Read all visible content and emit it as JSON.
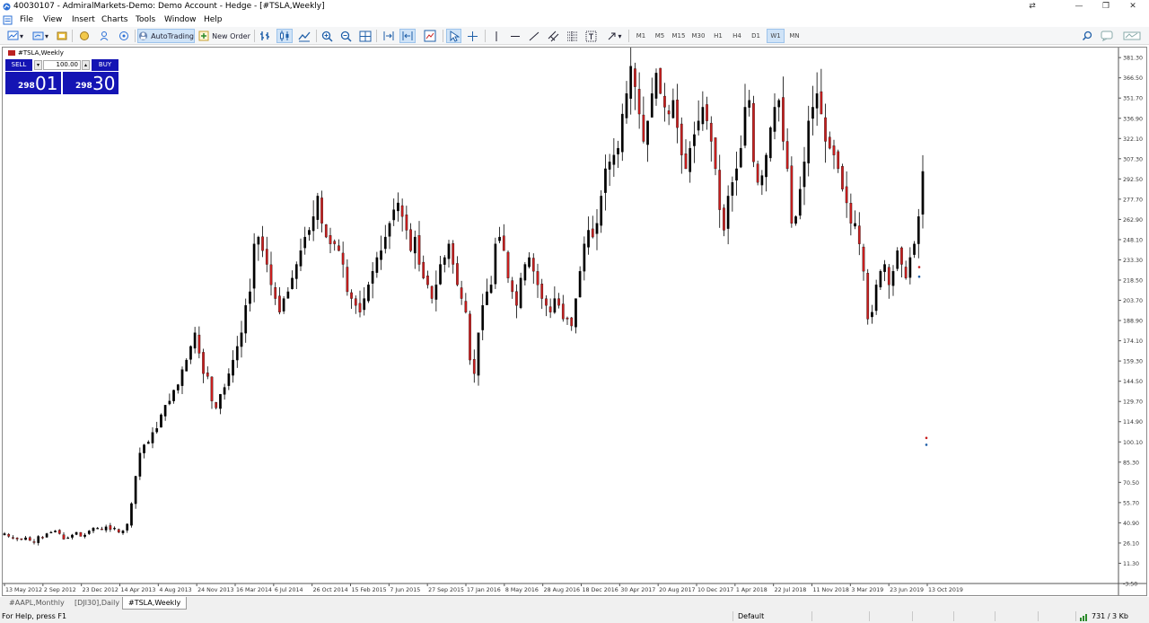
{
  "window": {
    "title": "40030107 - AdmiralMarkets-Demo: Demo Account - Hedge - [#TSLA,Weekly]"
  },
  "menu": [
    "File",
    "View",
    "Insert",
    "Charts",
    "Tools",
    "Window",
    "Help"
  ],
  "toolbar": {
    "autotrading_label": "AutoTrading",
    "new_order_label": "New Order",
    "timeframes": [
      "M1",
      "M5",
      "M15",
      "M30",
      "H1",
      "H4",
      "D1",
      "W1",
      "MN"
    ],
    "active_timeframe": "W1"
  },
  "chart": {
    "symbol_label": "#TSLA,Weekly",
    "oneclick": {
      "sell_label": "SELL",
      "buy_label": "BUY",
      "lot": "100.00",
      "sell_price_small": "298",
      "sell_price_big": "01",
      "buy_price_small": "298",
      "buy_price_big": "30"
    },
    "colors": {
      "bull": "#1e5a1e",
      "bear": "#c81e1e",
      "axis": "#555555"
    }
  },
  "chart_data": {
    "type": "candlestick",
    "symbol": "#TSLA",
    "timeframe": "Weekly",
    "y_ticks": [
      "381.30",
      "366.50",
      "351.70",
      "336.90",
      "322.10",
      "307.30",
      "292.50",
      "277.70",
      "262.90",
      "248.10",
      "233.30",
      "218.50",
      "203.70",
      "188.90",
      "174.10",
      "159.30",
      "144.50",
      "129.70",
      "114.90",
      "100.10",
      "85.30",
      "70.50",
      "55.70",
      "40.90",
      "26.10",
      "11.30",
      "-3.50"
    ],
    "x_ticks": [
      "13 May 2012",
      "2 Sep 2012",
      "23 Dec 2012",
      "14 Apr 2013",
      "4 Aug 2013",
      "24 Nov 2013",
      "16 Mar 2014",
      "6 Jul 2014",
      "26 Oct 2014",
      "15 Feb 2015",
      "7 Jun 2015",
      "27 Sep 2015",
      "17 Jan 2016",
      "8 May 2016",
      "28 Aug 2016",
      "18 Dec 2016",
      "30 Apr 2017",
      "20 Aug 2017",
      "10 Dec 2017",
      "1 Apr 2018",
      "22 Jul 2018",
      "11 Nov 2018",
      "3 Mar 2019",
      "23 Jun 2019",
      "13 Oct 2019"
    ],
    "ylim": [
      -3.5,
      386
    ],
    "close_series": [
      33,
      31,
      30,
      29,
      29,
      30,
      28,
      27,
      31,
      30,
      33,
      34,
      35,
      33,
      29,
      30,
      32,
      34,
      31,
      32,
      35,
      37,
      37,
      36,
      38,
      36,
      37,
      34,
      35,
      40,
      55,
      75,
      92,
      98,
      100,
      107,
      110,
      120,
      127,
      130,
      138,
      142,
      153,
      160,
      170,
      180,
      165,
      150,
      148,
      130,
      125,
      135,
      140,
      150,
      160,
      170,
      180,
      200,
      210,
      245,
      250,
      240,
      230,
      215,
      205,
      195,
      205,
      210,
      220,
      230,
      240,
      250,
      255,
      265,
      280,
      260,
      250,
      245,
      245,
      240,
      230,
      210,
      205,
      200,
      195,
      205,
      215,
      225,
      235,
      240,
      250,
      260,
      270,
      275,
      265,
      255,
      240,
      250,
      230,
      220,
      215,
      205,
      215,
      230,
      235,
      245,
      230,
      215,
      205,
      195,
      160,
      150,
      180,
      200,
      210,
      215,
      245,
      250,
      240,
      220,
      210,
      200,
      220,
      230,
      235,
      225,
      215,
      205,
      200,
      195,
      205,
      200,
      190,
      190,
      185,
      205,
      225,
      245,
      255,
      250,
      260,
      280,
      300,
      305,
      310,
      315,
      340,
      355,
      375,
      360,
      340,
      320,
      335,
      355,
      370,
      355,
      345,
      340,
      350,
      330,
      310,
      300,
      315,
      325,
      335,
      345,
      335,
      320,
      300,
      270,
      255,
      280,
      290,
      300,
      315,
      345,
      350,
      305,
      290,
      295,
      310,
      330,
      345,
      350,
      320,
      300,
      260,
      265,
      285,
      305,
      335,
      345,
      355,
      340,
      320,
      315,
      310,
      300,
      285,
      275,
      260,
      260,
      245,
      225,
      190,
      195,
      215,
      225,
      230,
      215,
      225,
      240,
      230,
      220,
      235,
      245,
      265,
      298
    ]
  },
  "tabs": [
    "#AAPL,Monthly",
    "[DJI30],Daily",
    "#TSLA,Weekly"
  ],
  "active_tab": "#TSLA,Weekly",
  "status": {
    "help": "For Help, press F1",
    "profile": "Default",
    "traffic": "731 / 3 Kb"
  }
}
